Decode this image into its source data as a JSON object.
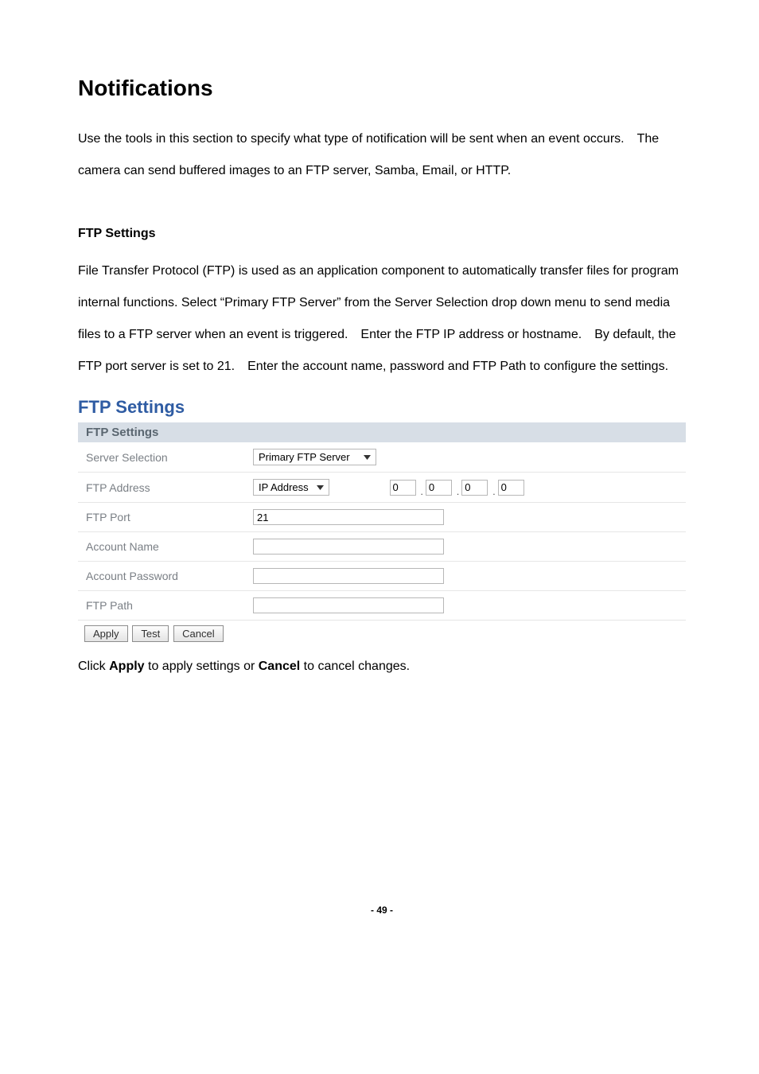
{
  "heading": "Notifications",
  "intro": "Use the tools in this section to specify what type of notification will be sent when an event occurs. The camera can send buffered images to an FTP server, Samba, Email, or HTTP.",
  "section": {
    "title": "FTP Settings",
    "description": "File Transfer Protocol (FTP) is used as an application component to automatically transfer files for program internal functions. Select “Primary FTP Server” from the Server Selection drop down menu to send media files to a FTP server when an event is triggered. Enter the FTP IP address or hostname. By default, the FTP port server is set to 21. Enter the account name, password and FTP Path to configure the settings."
  },
  "panel": {
    "title": "FTP Settings",
    "header": "FTP Settings",
    "rows": {
      "server_selection": {
        "label": "Server Selection",
        "value": "Primary FTP Server"
      },
      "ftp_address": {
        "label": "FTP Address",
        "type_value": "IP Address",
        "ip": [
          "0",
          "0",
          "0",
          "0"
        ]
      },
      "ftp_port": {
        "label": "FTP Port",
        "value": "21"
      },
      "account_name": {
        "label": "Account Name",
        "value": ""
      },
      "account_password": {
        "label": "Account Password",
        "value": ""
      },
      "ftp_path": {
        "label": "FTP Path",
        "value": ""
      }
    },
    "buttons": {
      "apply": "Apply",
      "test": "Test",
      "cancel": "Cancel"
    }
  },
  "footer_prefix": "Click ",
  "footer_apply": "Apply",
  "footer_mid": " to apply settings or ",
  "footer_cancel": "Cancel",
  "footer_suffix": " to cancel changes.",
  "page_num": "- 49 -"
}
